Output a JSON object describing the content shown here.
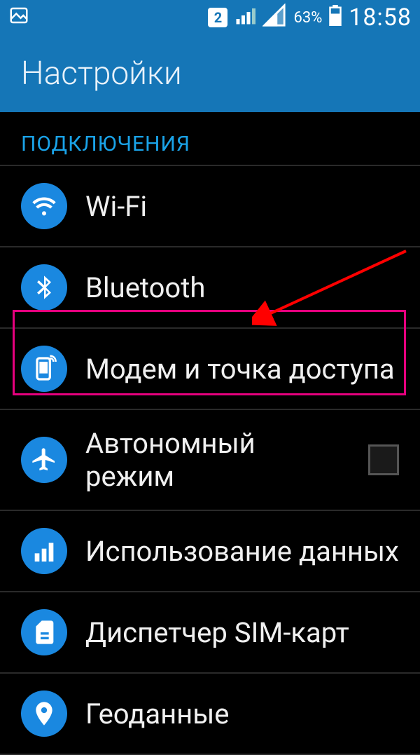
{
  "statusbar": {
    "sim_badge": "2",
    "battery_pct": "63%",
    "time": "18:58"
  },
  "title": "Настройки",
  "section": "ПОДКЛЮЧЕНИЯ",
  "items": {
    "wifi": "Wi-Fi",
    "bluetooth": "Bluetooth",
    "tether": "Модем и точка доступа",
    "airplane": "Автономный режим",
    "data_usage": "Использование данных",
    "sim": "Диспетчер SIM-карт",
    "geo": "Геоданные"
  }
}
